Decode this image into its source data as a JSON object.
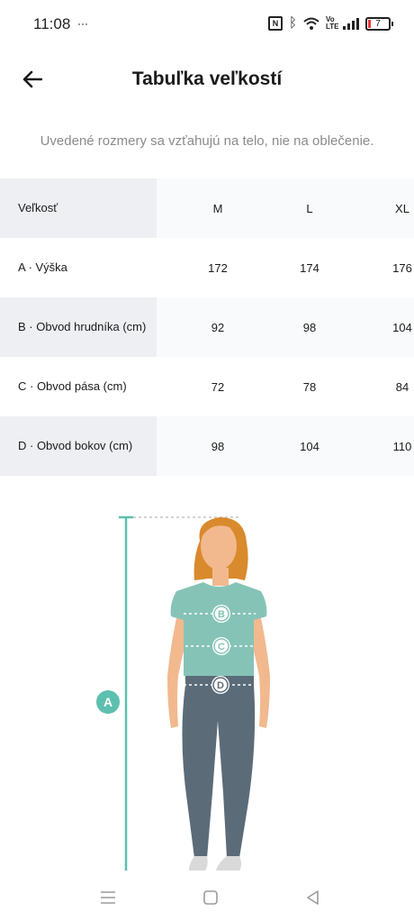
{
  "status_bar": {
    "time": "11:08",
    "battery_level": "7",
    "icons": [
      "nfc-icon",
      "bluetooth-icon",
      "wifi-icon",
      "volte-icon",
      "signal-icon",
      "battery-icon"
    ]
  },
  "header": {
    "title": "Tabuľka veľkostí",
    "back_icon": "arrow-left-icon"
  },
  "subtitle": "Uvedené rozmery sa vzťahujú na telo, nie na oblečenie.",
  "size_table": {
    "header": [
      "Veľkosť",
      "M",
      "L",
      "XL"
    ],
    "rows": [
      {
        "label": "A · Výška",
        "values": [
          "172",
          "174",
          "176"
        ]
      },
      {
        "label": "B · Obvod hrudníka (cm)",
        "values": [
          "92",
          "98",
          "104"
        ]
      },
      {
        "label": "C · Obvod pása (cm)",
        "values": [
          "72",
          "78",
          "84"
        ]
      },
      {
        "label": "D · Obvod bokov (cm)",
        "values": [
          "98",
          "104",
          "110"
        ]
      }
    ]
  },
  "illustration": {
    "markers": [
      "A",
      "B",
      "C",
      "D"
    ],
    "colors": {
      "accent": "#5dc0ae",
      "hair": "#d98a2c",
      "skin": "#f2b98f",
      "shirt": "#86c3b7",
      "pants": "#5b6b78"
    }
  },
  "nav_bar": {
    "icons": [
      "menu-icon",
      "home-icon",
      "back-triangle-icon"
    ]
  }
}
